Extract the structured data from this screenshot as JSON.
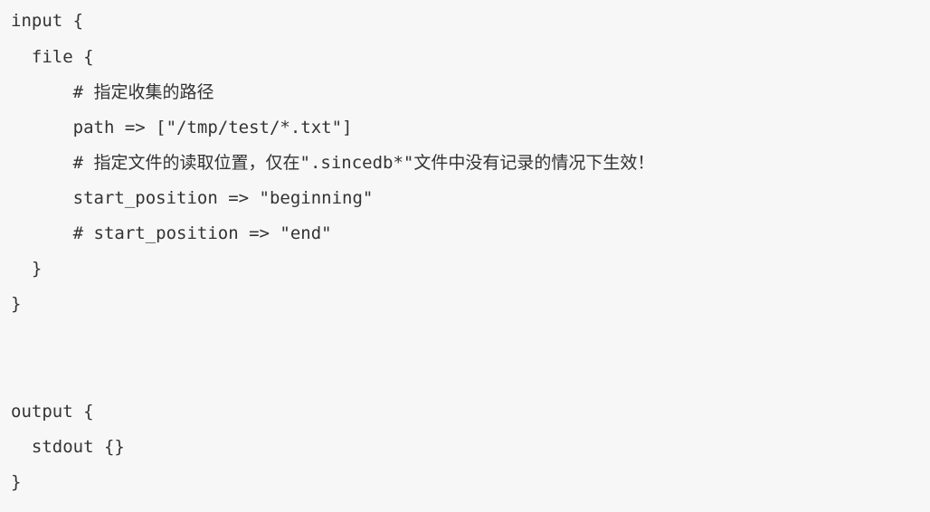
{
  "code": {
    "lines": [
      "input {",
      "  file {",
      "      # 指定收集的路径",
      "      path => [\"/tmp/test/*.txt\"]",
      "      # 指定文件的读取位置，仅在\".sincedb*\"文件中没有记录的情况下生效！",
      "      start_position => \"beginning\"",
      "      # start_position => \"end\"",
      "  }",
      "}",
      "",
      "",
      "output {",
      "  stdout {}",
      "}"
    ]
  }
}
